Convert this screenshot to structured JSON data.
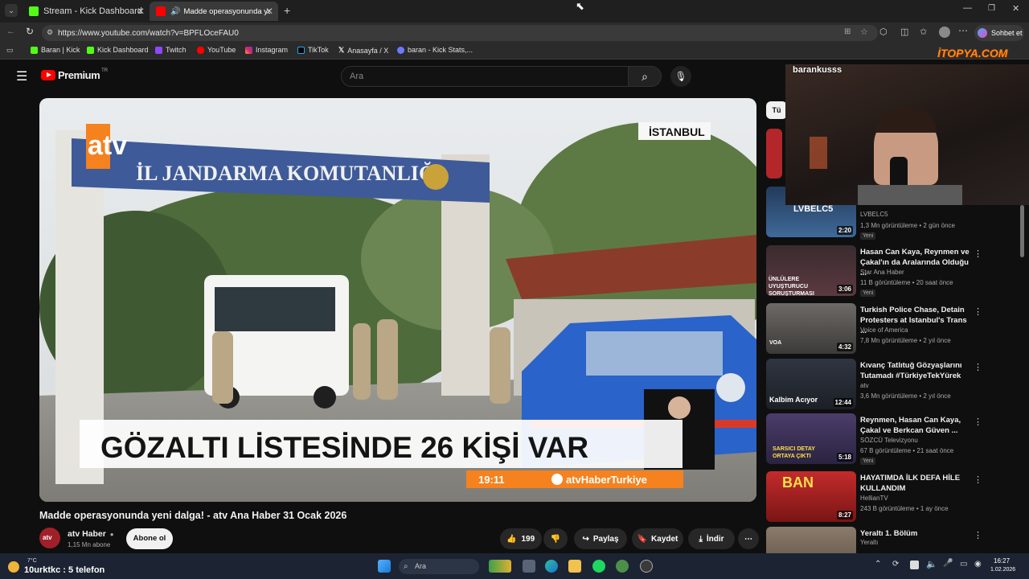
{
  "browser": {
    "tabs": [
      {
        "label": "Stream - Kick Dashboard"
      },
      {
        "label": "Madde operasyonunda yeni dalga"
      }
    ],
    "url": "https://www.youtube.com/watch?v=BPFLOceFAU0",
    "copilot_label": "Sohbet et",
    "bookmarks": [
      "Baran | Kick",
      "Kick Dashboard",
      "Twitch",
      "YouTube",
      "Instagram",
      "TikTok",
      "Anasayfa / X",
      "baran - Kick Stats,..."
    ]
  },
  "youtube": {
    "logo": "Premium",
    "logo_region": "TR",
    "search_placeholder": "Ara",
    "video": {
      "location_tag": "İSTANBUL",
      "sign_text": "İL JANDARMA KOMUTANLIĞI",
      "channel_logo_text": "atv",
      "headline": "GÖZALTI LİSTESİNDE 26 KİŞİ VAR",
      "clock": "19:11",
      "handle": "atvHaberTurkiye",
      "title": "Madde operasyonunda yeni dalga! - atv Ana Haber 31 Ocak 2026",
      "channel": "atv Haber",
      "subscribers": "1,15 Mn abone",
      "subscribe_label": "Abone ol",
      "likes": "199",
      "share_label": "Paylaş",
      "save_label": "Kaydet",
      "download_label": "İndir"
    },
    "filter_chip": "Tü",
    "recommendations": [
      {
        "title": "",
        "channel": "LVBELC5",
        "meta": "1,3 Mn görüntüleme • 2 gün önce",
        "badge": "Yeni",
        "duration": "2:20",
        "thumb_text": "LVBELC5"
      },
      {
        "title": "Hasan Can Kaya, Reynmen ve Çakal'ın da Aralarında Olduğu ...",
        "channel": "Star Ana Haber",
        "meta": "11 B görüntüleme • 20 saat önce",
        "badge": "Yeni",
        "duration": "3:06",
        "thumb_text": "ÜNLÜLERE UYUŞTURUCU SORUŞTURMASI"
      },
      {
        "title": "Turkish Police Chase, Detain Protesters at Istanbul's Trans ...",
        "channel": "Voice of America",
        "meta": "7,8 Mn görüntüleme • 2 yıl önce",
        "badge": "",
        "duration": "4:32",
        "thumb_text": "VOA"
      },
      {
        "title": "Kıvanç Tatlıtuğ Gözyaşlarını Tutamadı #TürkiyeTekYürek",
        "channel": "atv",
        "meta": "3,6 Mn görüntüleme • 2 yıl önce",
        "badge": "",
        "duration": "12:44",
        "thumb_text": "Kalbim Acıyor"
      },
      {
        "title": "Reynmen, Hasan Can Kaya, Çakal ve Berkcan Güven ...",
        "channel": "SÖZCÜ Televizyonu",
        "meta": "67 B görüntüleme • 21 saat önce",
        "badge": "Yeni",
        "duration": "5:18",
        "thumb_text": "SARSICI DETAY ORTAYA ÇIKTI"
      },
      {
        "title": "HAYATIMDA İLK DEFA HİLE KULLANDIM",
        "channel": "HellianTV",
        "meta": "243 B görüntüleme • 1 ay önce",
        "badge": "",
        "duration": "8:27",
        "thumb_text": "BAN"
      },
      {
        "title": "Yeraltı 1. Bölüm",
        "channel": "Yeraltı",
        "meta": "",
        "badge": "",
        "duration": "",
        "thumb_text": ""
      }
    ]
  },
  "stream_overlay": {
    "username": "barankusss",
    "watermark": "İTOPYA.COM"
  },
  "taskbar": {
    "weather": "7°C",
    "ticker": "10urktkc : 5 telefon",
    "search_placeholder": "Ara",
    "time": "16:27",
    "date": "1.02.2026"
  },
  "colors": {
    "kick_green": "#53fc18",
    "youtube_red": "#ff0000",
    "atv_orange": "#f5821f",
    "gendarmerie_blue": "#2a63c9"
  }
}
